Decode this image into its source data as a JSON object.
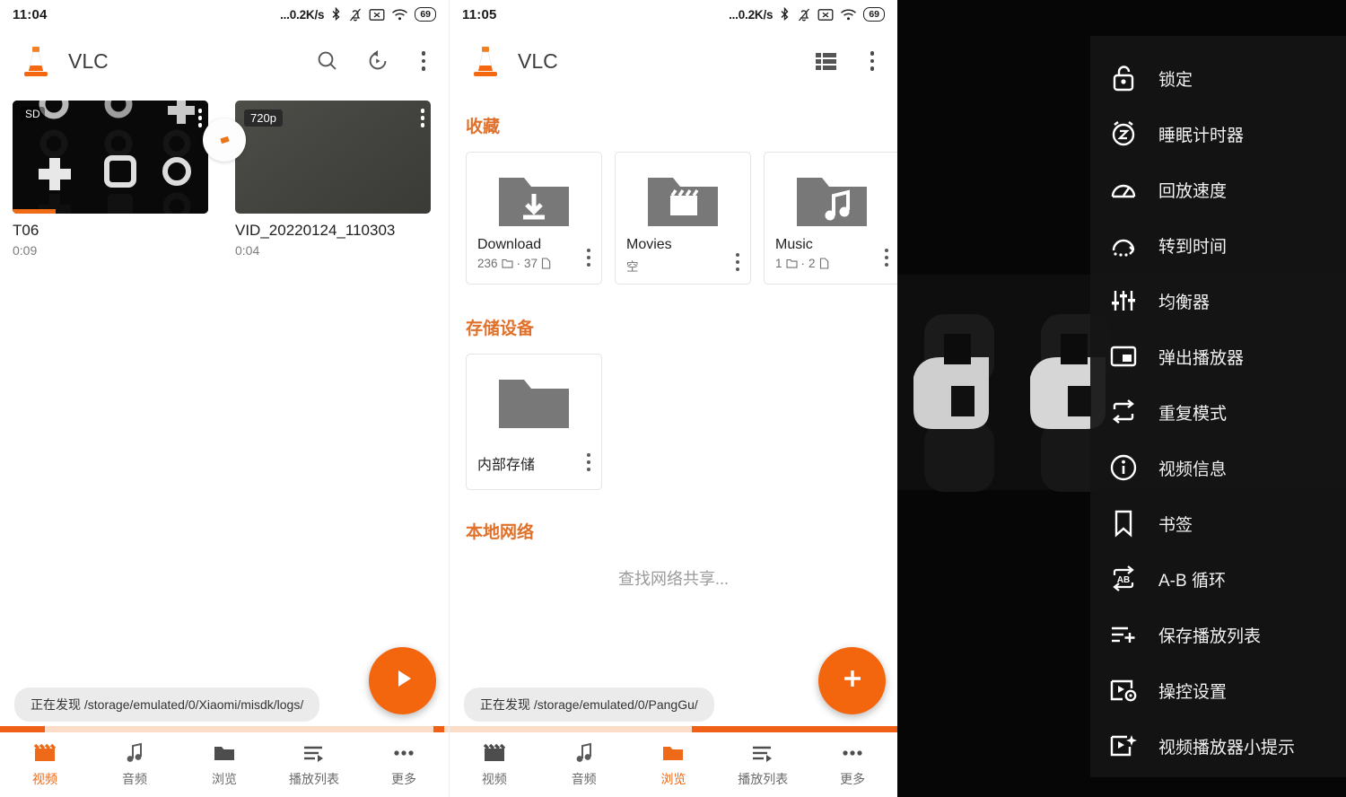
{
  "panel1": {
    "statusbar": {
      "time": "11:04",
      "speed": "...0.2K/s",
      "battery": "69"
    },
    "appbar": {
      "title": "VLC"
    },
    "videos": [
      {
        "title": "T06",
        "duration": "0:09",
        "quality": "SD",
        "watched_percent": 22
      },
      {
        "title": "VID_20220124_110303",
        "duration": "0:04",
        "quality": "720p",
        "watched_percent": 0
      }
    ],
    "toast": {
      "prefix": "正在发现",
      "path": "/storage/emulated/0/Xiaomi/misdk/logs/"
    },
    "fab": "play-icon",
    "bottom_nav": [
      {
        "label": "视频",
        "icon": "movie-icon",
        "active": true
      },
      {
        "label": "音频",
        "icon": "music-note-icon",
        "active": false
      },
      {
        "label": "浏览",
        "icon": "folder-icon",
        "active": false
      },
      {
        "label": "播放列表",
        "icon": "playlist-icon",
        "active": false
      },
      {
        "label": "更多",
        "icon": "more-icon",
        "active": false
      }
    ]
  },
  "panel2": {
    "statusbar": {
      "time": "11:05",
      "speed": "...0.2K/s",
      "battery": "69"
    },
    "appbar": {
      "title": "VLC"
    },
    "sections": {
      "favorites_title": "收藏",
      "storage_title": "存储设备",
      "network_title": "本地网络",
      "network_empty": "查找网络共享..."
    },
    "favorites": [
      {
        "name": "Download",
        "icon": "folder-download-icon",
        "folders": "236",
        "files": "37",
        "empty_label": ""
      },
      {
        "name": "Movies",
        "icon": "folder-movie-icon",
        "folders": "",
        "files": "",
        "empty_label": "空"
      },
      {
        "name": "Music",
        "icon": "folder-music-icon",
        "folders": "1",
        "files": "2",
        "empty_label": ""
      }
    ],
    "storage": [
      {
        "name": "内部存储",
        "icon": "folder-icon"
      }
    ],
    "toast": {
      "prefix": "正在发现",
      "path": "/storage/emulated/0/PangGu/"
    },
    "fab": "plus-icon",
    "bottom_nav": [
      {
        "label": "视频",
        "icon": "movie-icon",
        "active": false
      },
      {
        "label": "音频",
        "icon": "music-note-icon",
        "active": false
      },
      {
        "label": "浏览",
        "icon": "folder-icon",
        "active": true
      },
      {
        "label": "播放列表",
        "icon": "playlist-icon",
        "active": false
      },
      {
        "label": "更多",
        "icon": "more-icon",
        "active": false
      }
    ]
  },
  "panel3": {
    "menu_items": [
      {
        "label": "锁定",
        "icon": "lock-icon"
      },
      {
        "label": "睡眠计时器",
        "icon": "sleep-timer-icon"
      },
      {
        "label": "回放速度",
        "icon": "speed-icon"
      },
      {
        "label": "转到时间",
        "icon": "jump-to-time-icon"
      },
      {
        "label": "均衡器",
        "icon": "equalizer-icon"
      },
      {
        "label": "弹出播放器",
        "icon": "popup-player-icon"
      },
      {
        "label": "重复模式",
        "icon": "repeat-icon"
      },
      {
        "label": "视频信息",
        "icon": "info-icon"
      },
      {
        "label": "书签",
        "icon": "bookmark-icon"
      },
      {
        "label": "A-B 循环",
        "icon": "ab-repeat-icon"
      },
      {
        "label": "保存播放列表",
        "icon": "save-playlist-icon"
      },
      {
        "label": "操控设置",
        "icon": "player-settings-icon"
      },
      {
        "label": "视频播放器小提示",
        "icon": "player-tips-icon"
      }
    ]
  },
  "colors": {
    "accent": "#f4660d",
    "section_header": "#e0702a",
    "scan_track": "#fbddc8",
    "scan_fill": "#ef5f16"
  }
}
